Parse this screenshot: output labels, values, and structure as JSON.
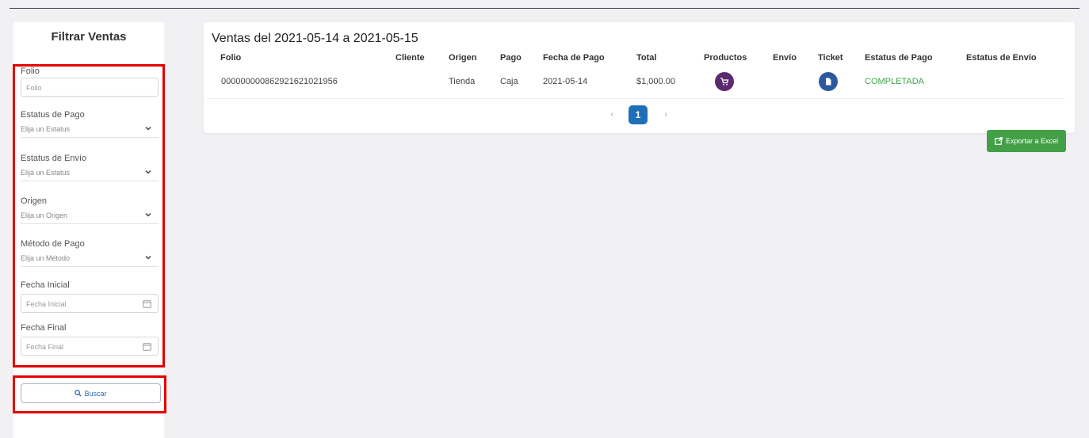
{
  "sidebar": {
    "title": "Filtrar Ventas",
    "folio": {
      "label": "Folio",
      "placeholder": "Folio"
    },
    "estatus_pago": {
      "label": "Estatus de Pago",
      "value": "Elija un Estatus"
    },
    "estatus_envio": {
      "label": "Estatus de Envío",
      "value": "Elija un Estatus"
    },
    "origen": {
      "label": "Origen",
      "value": "Elija un Origen"
    },
    "metodo_pago": {
      "label": "Método de Pago",
      "value": "Elija un Método"
    },
    "fecha_inicial": {
      "label": "Fecha Inicial",
      "placeholder": "Fecha Inicial"
    },
    "fecha_final": {
      "label": "Fecha Final",
      "placeholder": "Fecha Final"
    },
    "buscar_label": "Buscar"
  },
  "main": {
    "title": "Ventas del 2021-05-14 a 2021-05-15",
    "columns": [
      "Folio",
      "Cliente",
      "Origen",
      "Pago",
      "Fecha de Pago",
      "Total",
      "Productos",
      "Envío",
      "Ticket",
      "Estatus de Pago",
      "Estatus de Envío"
    ],
    "rows": [
      {
        "folio": "000000000862921621021956",
        "cliente": "",
        "origen": "Tienda",
        "pago": "Caja",
        "fecha_pago": "2021-05-14",
        "total": "$1,000.00",
        "productos_icon": "cart-icon",
        "envio": "",
        "ticket_icon": "document-icon",
        "estatus_pago": "COMPLETADA",
        "estatus_envio": ""
      }
    ],
    "pagination": {
      "prev": "‹",
      "current": "1",
      "next": "›"
    },
    "export_label": "Exportar a Excel"
  },
  "colors": {
    "highlight": "#e30000",
    "productos_button": "#5b2a6e",
    "ticket_button": "#2b5aa0",
    "page_active": "#1f6fb8",
    "export": "#43a047",
    "status_completed": "#3aa64a"
  }
}
